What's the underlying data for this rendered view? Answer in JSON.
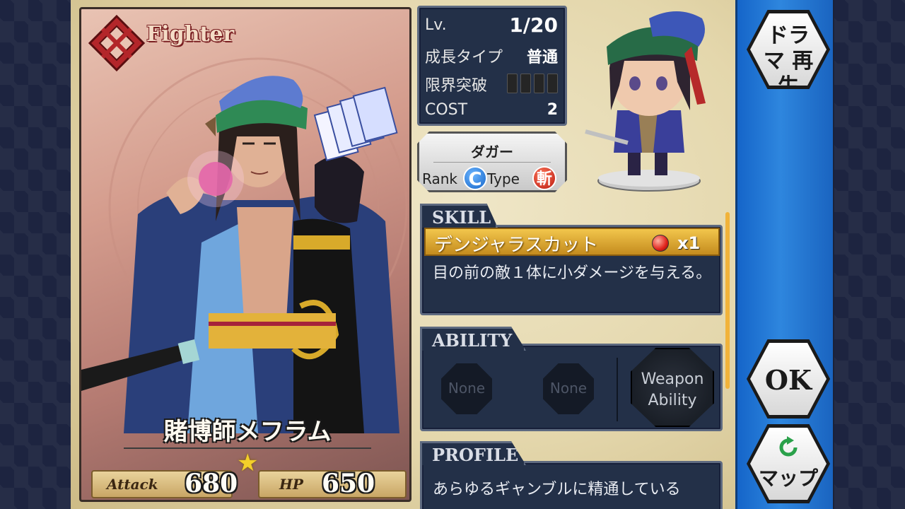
{
  "card": {
    "class": "Fighter",
    "name": "賭博師メフラム",
    "rarity": 1,
    "attack_label": "Attack",
    "attack_value": "680",
    "hp_label": "HP",
    "hp_value": "650"
  },
  "stats": {
    "level_label": "Lv.",
    "level_value": "1/20",
    "growth_label": "成長タイプ",
    "growth_value": "普通",
    "limit_label": "限界突破",
    "limit_filled": 0,
    "limit_max": 4,
    "cost_label": "COST",
    "cost_value": "2"
  },
  "weapon": {
    "name": "ダガー",
    "rank_label": "Rank",
    "rank_value": "C",
    "type_label": "Type",
    "type_value": "斬"
  },
  "skill": {
    "header": "SKILL",
    "name": "デンジャラスカット",
    "orb_color": "#e0221a",
    "count": "x1",
    "description": "目の前の敵１体に小ダメージを与える。"
  },
  "ability": {
    "header": "ABILITY",
    "slot1": "None",
    "slot2": "None",
    "weapon_ability": "Weapon Ability"
  },
  "profile": {
    "header": "PROFILE",
    "text": "あらゆるギャンブルに精通している"
  },
  "buttons": {
    "drama": "ドラマ 再生",
    "ok": "OK",
    "map": "マップ",
    "map_icon": "refresh-arrow-icon"
  },
  "colors": {
    "accent_gold": "#f2c64c",
    "panel_navy": "#233048",
    "side_blue": "#2e86de"
  }
}
